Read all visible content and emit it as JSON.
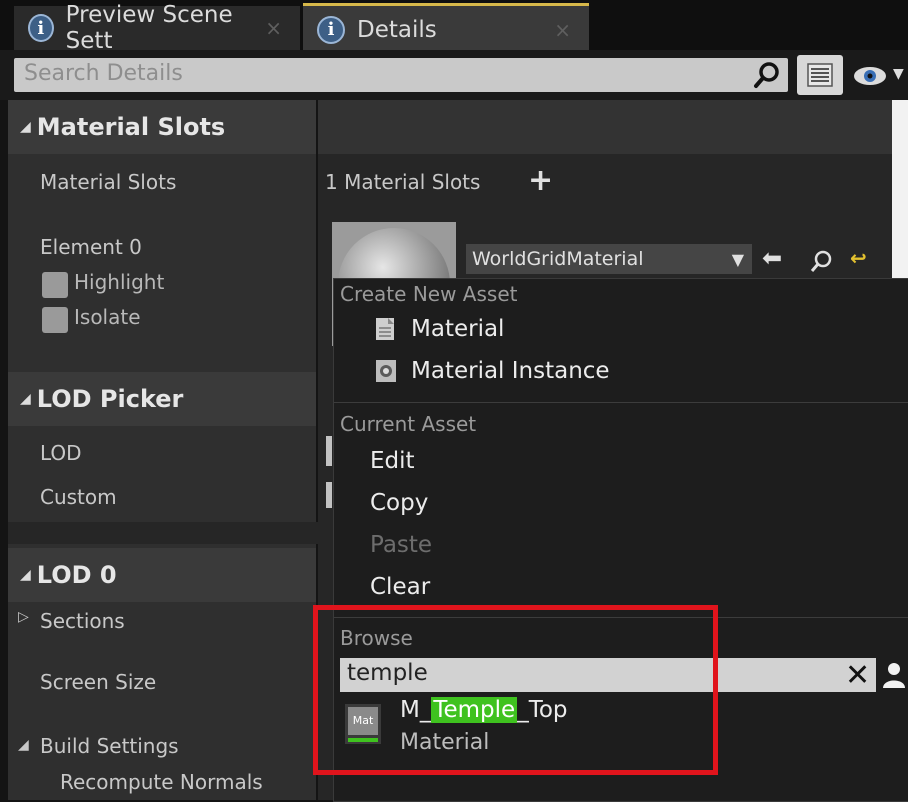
{
  "tabs": [
    {
      "label": "Preview Scene Sett",
      "icon": "info-icon"
    },
    {
      "label": "Details",
      "icon": "info-icon"
    }
  ],
  "search": {
    "placeholder": "Search Details"
  },
  "categories": {
    "material_slots": "Material Slots",
    "lod_picker": "LOD Picker",
    "lod0": "LOD 0"
  },
  "material_slots": {
    "row_label": "Material Slots",
    "count_label": "1 Material Slots",
    "element_label": "Element 0",
    "highlight": "Highlight",
    "isolate": "Isolate",
    "material_name": "WorldGridMaterial"
  },
  "lod_picker": {
    "lod": "LOD",
    "custom": "Custom"
  },
  "lod0": {
    "sections": "Sections",
    "screen_size": "Screen Size",
    "build_settings": "Build Settings",
    "recompute_normals": "Recompute Normals"
  },
  "menu": {
    "create_header": "Create New Asset",
    "create_items": [
      "Material",
      "Material Instance"
    ],
    "current_header": "Current Asset",
    "edit": "Edit",
    "copy": "Copy",
    "paste": "Paste",
    "clear": "Clear",
    "browse_header": "Browse",
    "browse_query": "temple",
    "result": {
      "name_prefix": "M_",
      "name_match": "Temple",
      "name_suffix": "_Top",
      "type": "Material",
      "thumb_label": "Mat"
    }
  },
  "colors": {
    "highlight_box": "#e0141c",
    "match_highlight": "#3fc21f",
    "active_tab_accent": "#d7b84a"
  }
}
